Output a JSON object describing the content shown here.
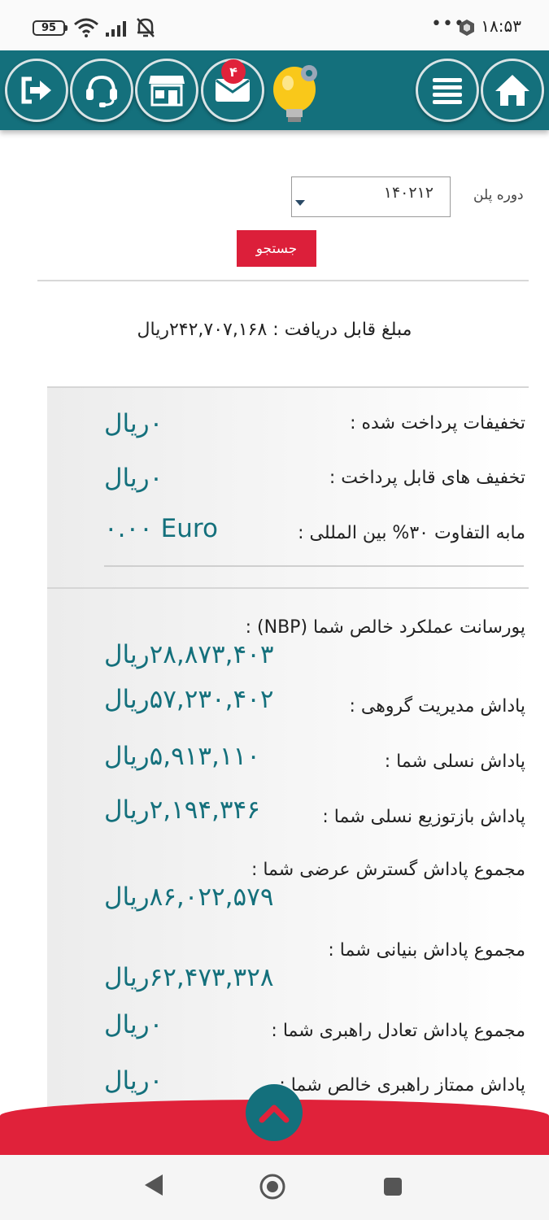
{
  "status_bar": {
    "battery": "95",
    "dots": "•••",
    "time": "۱۸:۵۳"
  },
  "topnav": {
    "mail_badge": "۴",
    "icons": [
      "logout-icon",
      "headset-icon",
      "store-icon",
      "mail-icon",
      "lightbulb-icon",
      "menu-icon",
      "home-icon"
    ]
  },
  "search": {
    "plan_label": "دوره پلن",
    "plan_value": "۱۴۰۲۱۲",
    "button_label": "جستجو"
  },
  "summary": {
    "receivable": "مبلغ قابل دریافت : ۲۴۲,۷۰۷,۱۶۸ریال"
  },
  "discounts": [
    {
      "label": "تخفیفات پرداخت شده :",
      "value": "۰ریال"
    },
    {
      "label": "تخفیف های قابل پرداخت :",
      "value": "۰ریال"
    },
    {
      "label": "مابه التفاوت ۳۰% بین المللی :",
      "value": "۰.۰۰ Euro"
    }
  ],
  "rewards": [
    {
      "label": "پورسانت عملکرد خالص شما (NBP) :",
      "value": "۲۸,۸۷۳,۴۰۳ریال"
    },
    {
      "label": "پاداش مدیریت گروهی :",
      "value": "۵۷,۲۳۰,۴۰۲ریال"
    },
    {
      "label": "پاداش نسلی شما :",
      "value": "۵,۹۱۳,۱۱۰ریال"
    },
    {
      "label": "پاداش بازتوزیع نسلی شما :",
      "value": "۲,۱۹۴,۳۴۶ریال"
    },
    {
      "label": "مجموع پاداش گسترش عرضی شما :",
      "value": "۸۶,۰۲۲,۵۷۹ریال"
    },
    {
      "label": "مجموع پاداش بنیانی شما :",
      "value": "۶۲,۴۷۳,۳۲۸ریال"
    },
    {
      "label": "مجموع پاداش تعادل راهبری شما :",
      "value": "۰ریال"
    },
    {
      "label": "پاداش ممتاز راهبری خالص شما :",
      "value": "۰ریال"
    }
  ],
  "colors": {
    "teal": "#14707c",
    "red": "#e0223a",
    "button_red": "#dc1f3a"
  }
}
